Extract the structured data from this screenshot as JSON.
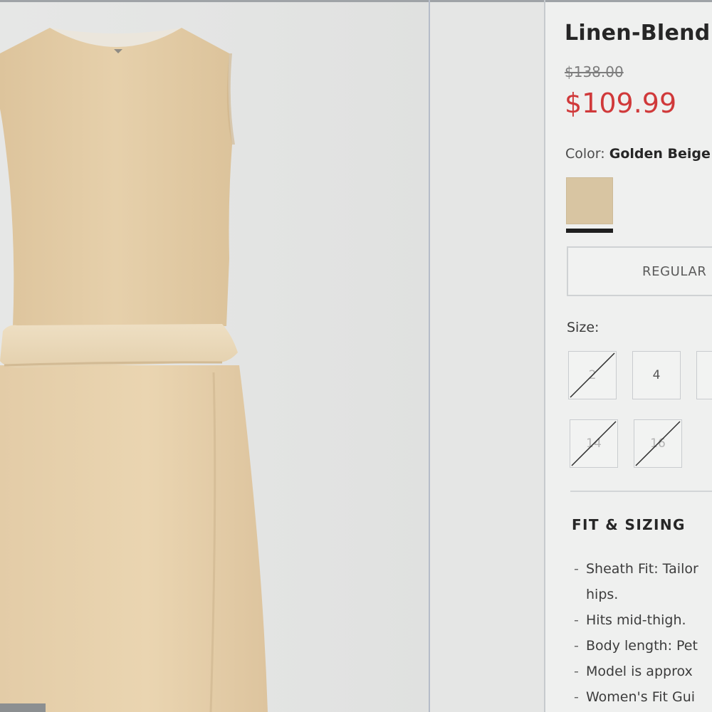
{
  "product": {
    "title": "Linen-Blend",
    "original_price": "$138.00",
    "sale_price": "$109.99"
  },
  "color": {
    "label": "Color:",
    "selected": "Golden Beige",
    "swatch_hex": "#d8c5a2"
  },
  "fit_tab": {
    "label": "REGULAR"
  },
  "size": {
    "label": "Size:",
    "options": [
      {
        "label": "2",
        "available": false
      },
      {
        "label": "4",
        "available": true
      },
      {
        "label": "",
        "available": true
      },
      {
        "label": "14",
        "available": false
      },
      {
        "label": "16",
        "available": false
      }
    ]
  },
  "fit_sizing": {
    "heading": "FIT & SIZING",
    "items": [
      {
        "line1": "Sheath Fit: Tailor",
        "line2": "hips."
      },
      {
        "line1": "Hits mid-thigh."
      },
      {
        "line1": "Body length: Pet"
      },
      {
        "line1": "Model is approx"
      },
      {
        "line1": "Women's Fit Gui"
      }
    ]
  },
  "colors": {
    "sale_red": "#d0393a",
    "dress_beige": "#e2cba6",
    "selected_underline": "#1f1f1f"
  }
}
